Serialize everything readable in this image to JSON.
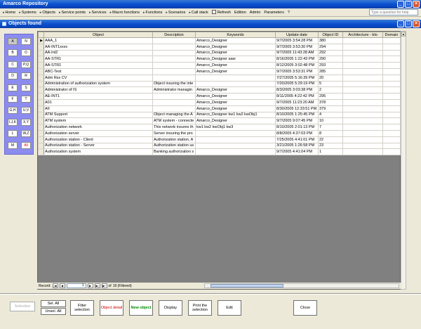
{
  "app_title": "Amarco Repository",
  "menu": {
    "items": [
      {
        "label": "Home"
      },
      {
        "label": "Systems"
      },
      {
        "label": "Objects"
      },
      {
        "label": "Service points"
      },
      {
        "label": "Services"
      },
      {
        "label": "Macro functions"
      },
      {
        "label": "Functions"
      },
      {
        "label": "Scenarios"
      },
      {
        "label": "Call stack"
      },
      {
        "label": "Refresh"
      },
      {
        "label": "Edition"
      },
      {
        "label": "Admin"
      },
      {
        "label": "Parameters"
      },
      {
        "label": "?"
      }
    ],
    "help_placeholder": "Type a question for help"
  },
  "child_title": "Objects found",
  "letters": [
    "A",
    "B",
    "C",
    "D",
    "E",
    "F",
    "G,H",
    "I,J,K",
    "L",
    "M",
    "N",
    "O",
    "P,Q",
    "R",
    "S",
    "T",
    "U,V",
    "X,Y",
    "W,Z",
    "All"
  ],
  "grid": {
    "columns": [
      "Object",
      "Description",
      "Keywords",
      "Update date",
      "Object ID",
      "Architecture - blo",
      "Domain"
    ],
    "rows": [
      [
        "AAA_1",
        "",
        "Amarco_Designer",
        "9/7/2005 3:54:28 PM",
        "380",
        "",
        ""
      ],
      [
        "AA-INT1xxxx",
        "",
        "Amarco_Designer",
        "9/7/2005 3:53:30 PM",
        "294",
        "",
        ""
      ],
      [
        "AA-Int2",
        "",
        "Amarco_Designer",
        "9/7/2005 11:43:28 AM",
        "292",
        "",
        ""
      ],
      [
        "AA-STR1",
        "",
        "Amarco_Designer aaw",
        "8/16/2005 1:22:43 PM",
        "290",
        "",
        ""
      ],
      [
        "AA-STR1",
        "",
        "Amarco_Designer",
        "8/12/2005 3:02:48 PM",
        "293",
        "",
        ""
      ],
      [
        "ABC-Test",
        "",
        "Amarco_Designer",
        "9/7/2005 3:53:31 PM",
        "285",
        "",
        ""
      ],
      [
        "Adm Rsx CV",
        "",
        "",
        "7/27/2005 5:16:39 PM",
        "20",
        "",
        ""
      ],
      [
        "Administration of authorization system",
        "Object insuring the inte",
        "",
        "7/20/2005 5:29:19 PM",
        "5",
        "",
        ""
      ],
      [
        "Administrator of IS",
        "Administrator managin",
        "Amarco_Designer",
        "8/3/2005 3:03:38 PM",
        "2",
        "",
        ""
      ],
      [
        "AE-INT1",
        "",
        "Amarco_Designer",
        "8/11/2005 4:22:42 PM",
        "295",
        "",
        ""
      ],
      [
        "A01",
        "",
        "Amarco_Designer",
        "9/7/2005 11:23:20 AM",
        "378",
        "",
        ""
      ],
      [
        "AII",
        "",
        "Amarco_Designer",
        "8/30/2005 12:33:51 PM",
        "379",
        "",
        ""
      ],
      [
        "ATM Support",
        "Object managing the A",
        "Amarco_Designer kw1 kw2 kwObj1",
        "8/10/2005 1:25:45 PM",
        "4",
        "",
        ""
      ],
      [
        "ATM system",
        "ATM system - connecte",
        "Amarco_Designer",
        "9/7/2005 9:07:45 PM",
        "10",
        "",
        ""
      ],
      [
        "Authorization network",
        "This network insures th",
        "kw1 kw2 kwObj1 kw3",
        "8/10/2005 2:01:13 PM",
        "7",
        "",
        ""
      ],
      [
        "Authorization server",
        "Server insuring the pro",
        "",
        "8/8/2005 4:37:03 PM",
        "8",
        "",
        ""
      ],
      [
        "Authorization station - Client",
        "Authorization station, A",
        "",
        "7/25/2005 4:41:01 PM",
        "22",
        "",
        ""
      ],
      [
        "Authorization station - Server",
        "Authorization station us",
        "",
        "3/21/2005 1:26:58 PM",
        "23",
        "",
        ""
      ],
      [
        "Authorization system",
        "Banking authorization s",
        "",
        "9/7/2005 4:41:04 PM",
        "1",
        "",
        ""
      ]
    ]
  },
  "navigator": {
    "record_label": "Record:",
    "current": "1",
    "of_label": "of",
    "total": "19 (Filtered)"
  },
  "buttons": {
    "selection": "Selection",
    "sel_all": "Sel. All",
    "unsel_all": "Unsel. All",
    "filter_selection": "Filter selection",
    "object_detail": "Object detail",
    "new_object": "New object",
    "display": "Display",
    "print_selection": "Print the selection",
    "edit": "Edit",
    "close": "Close"
  }
}
